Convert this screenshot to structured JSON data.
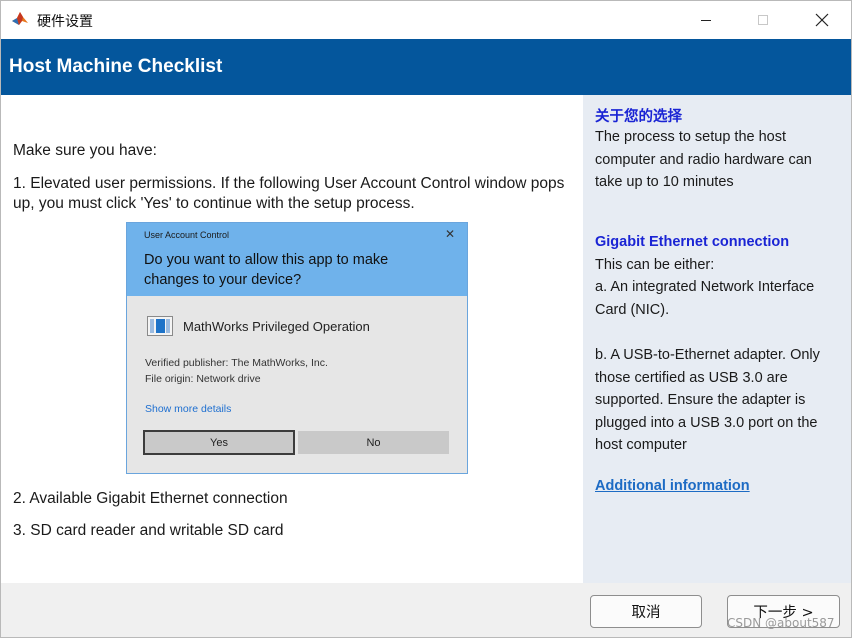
{
  "window": {
    "title": "硬件设置",
    "icon": "matlab-icon"
  },
  "header": {
    "title": "Host Machine Checklist"
  },
  "main": {
    "intro": "Make sure you have:",
    "item1": "1. Elevated user permissions. If the following User Account Control window pops up, you must click 'Yes' to continue with the setup process.",
    "item2": "2. Available Gigabit Ethernet connection",
    "item3": "3. SD card reader and writable SD card",
    "uac": {
      "caption": "User Account Control",
      "question": "Do you want to allow this app to make changes to your device?",
      "program": "MathWorks Privileged Operation",
      "publisher": "Verified publisher: The MathWorks, Inc.",
      "origin": "File origin: Network drive",
      "more_details": "Show more details",
      "yes": "Yes",
      "no": "No"
    }
  },
  "side": {
    "section1_title": "关于您的选择",
    "section1_text": "The process to setup the host computer and radio hardware can take up to 10 minutes",
    "section2_title": "Gigabit Ethernet connection",
    "section2_line1": "This can be either:",
    "section2_line2": "a. An integrated Network Interface Card (NIC).",
    "section2_line3": "b. A USB-to-Ethernet adapter. Only those certified as USB 3.0 are supported. Ensure the adapter is plugged into a USB 3.0 port on the host computer",
    "link": "Additional information"
  },
  "footer": {
    "cancel": "取消",
    "next": "下一步 >"
  },
  "watermark": "CSDN @about587",
  "colors": {
    "header_bg": "#04569c",
    "side_bg": "#e7ecf3",
    "side_heading": "#1a24d4",
    "link": "#1d6bc4",
    "uac_top": "#6fb2eb"
  }
}
